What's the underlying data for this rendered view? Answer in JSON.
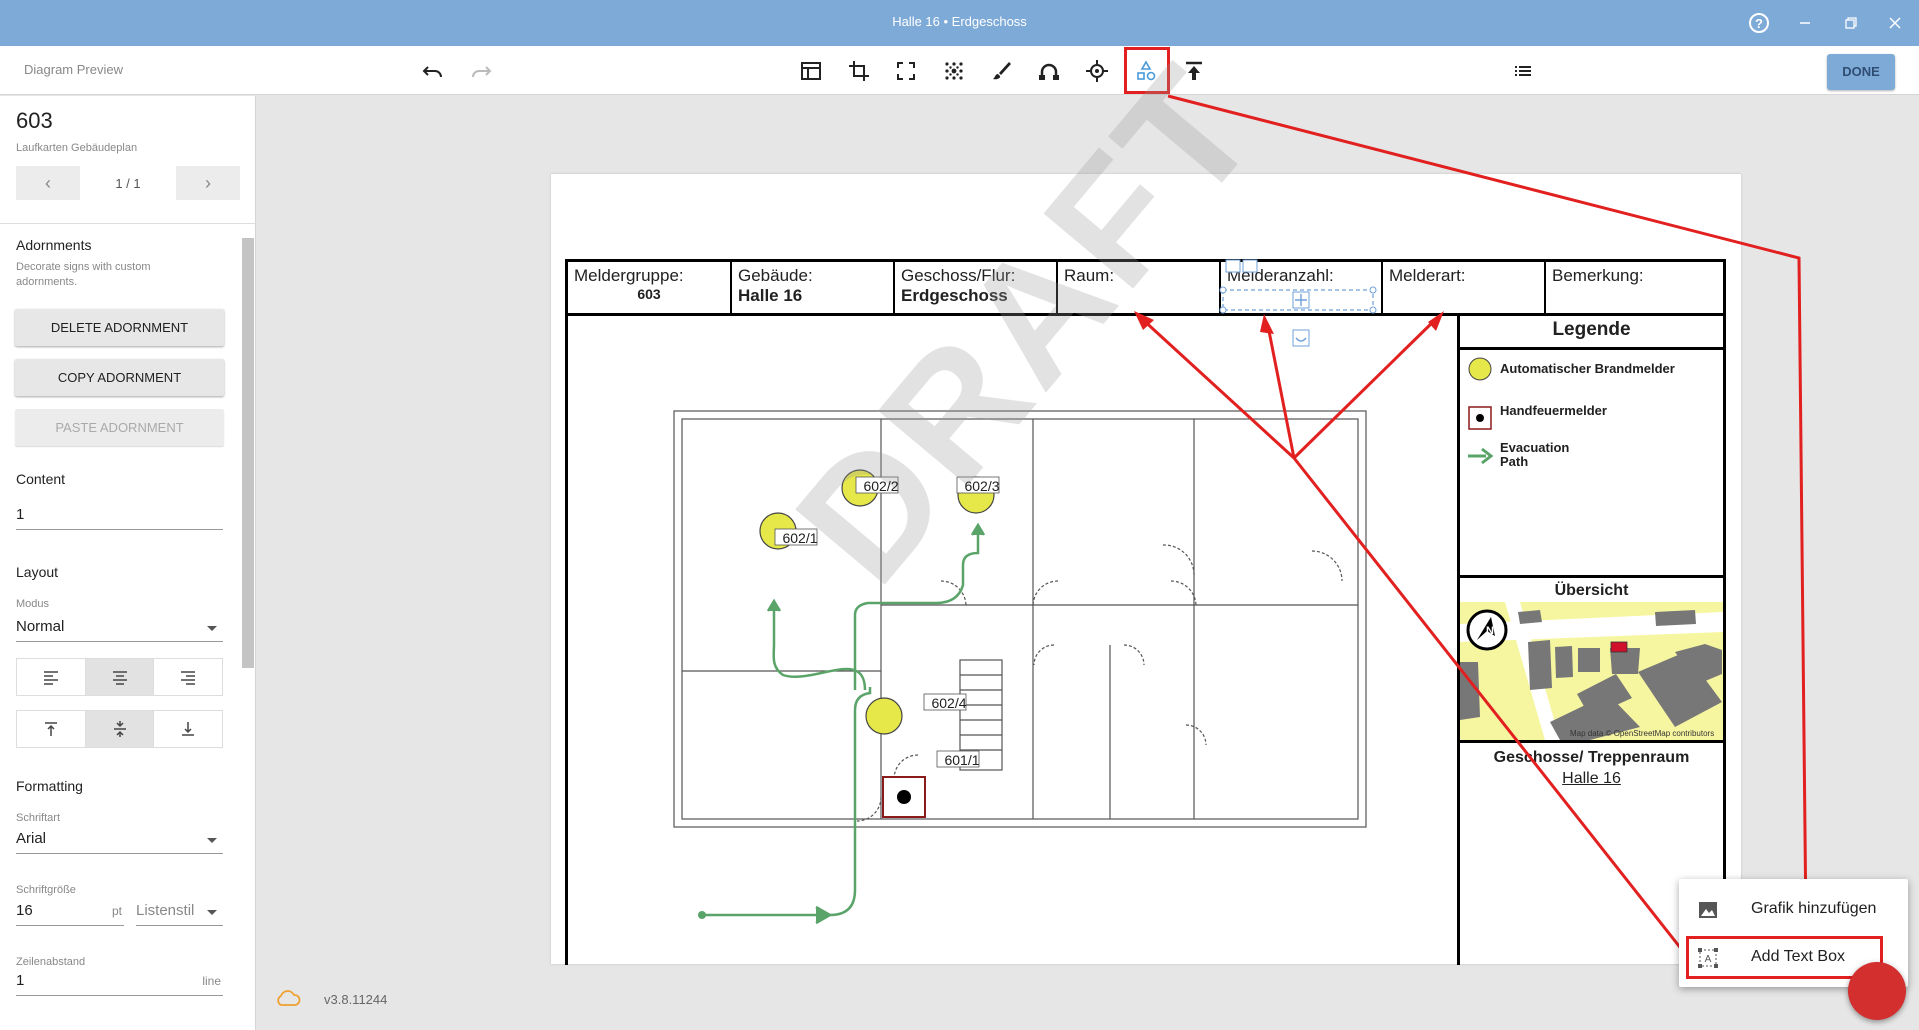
{
  "window": {
    "title": "Halle 16 • Erdgeschoss",
    "help_icon": "help-circle-icon",
    "minimize_icon": "minimize-icon",
    "restore_icon": "restore-icon",
    "close_icon": "close-icon"
  },
  "toolbar": {
    "label": "Diagram Preview",
    "done_label": "DONE"
  },
  "sidebar": {
    "sign_number": "603",
    "sign_subtitle": "Laufkarten Gebäudeplan",
    "page_indicator": "1 / 1",
    "adornments_title": "Adornments",
    "adornments_desc": "Decorate signs with custom adornments.",
    "delete_label": "DELETE ADORNMENT",
    "copy_label": "COPY ADORNMENT",
    "paste_label": "PASTE ADORNMENT",
    "content_title": "Content",
    "content_value": "1",
    "layout_title": "Layout",
    "modus_label": "Modus",
    "modus_value": "Normal",
    "formatting_title": "Formatting",
    "font_label": "Schriftart",
    "font_value": "Arial",
    "size_label": "Schriftgröße",
    "size_value": "16",
    "size_unit": "pt",
    "list_style": "Listenstil",
    "line_label": "Zeilenabstand",
    "line_value": "1",
    "line_unit": "line"
  },
  "footer": {
    "version": "v3.8.11244"
  },
  "sign": {
    "header": [
      {
        "label": "Meldergruppe:",
        "value": "603"
      },
      {
        "label": "Gebäude:",
        "value": "Halle 16"
      },
      {
        "label": "Geschoss/Flur:",
        "value": "Erdgeschoss"
      },
      {
        "label": "Raum:",
        "value": ""
      },
      {
        "label": "Melderanzahl:",
        "value": ""
      },
      {
        "label": "Melderart:",
        "value": ""
      },
      {
        "label": "Bemerkung:",
        "value": ""
      }
    ],
    "watermark": "DRAFT",
    "room_labels": [
      "602/1",
      "602/2",
      "602/3",
      "602/4",
      "601/1"
    ],
    "legend_title": "Legende",
    "legend_items": [
      "Automatischer Brandmelder",
      "Handfeuermelder",
      "Evacuation Path"
    ],
    "overview_title": "Übersicht",
    "map_credit": "Map data © OpenStreetMap contributors",
    "floors_title": "Geschosse/ Treppenraum",
    "floors_link": "Halle 16"
  },
  "popup": {
    "items": [
      {
        "label": "Grafik hinzufügen",
        "icon": "image-icon"
      },
      {
        "label": "Add Text Box",
        "icon": "text-box-icon"
      }
    ]
  },
  "colors": {
    "titlebar": "#7eaad8",
    "annotation_red": "#e1201f",
    "detector_yellow": "#e6e84a",
    "evac_green": "#5aa469"
  }
}
